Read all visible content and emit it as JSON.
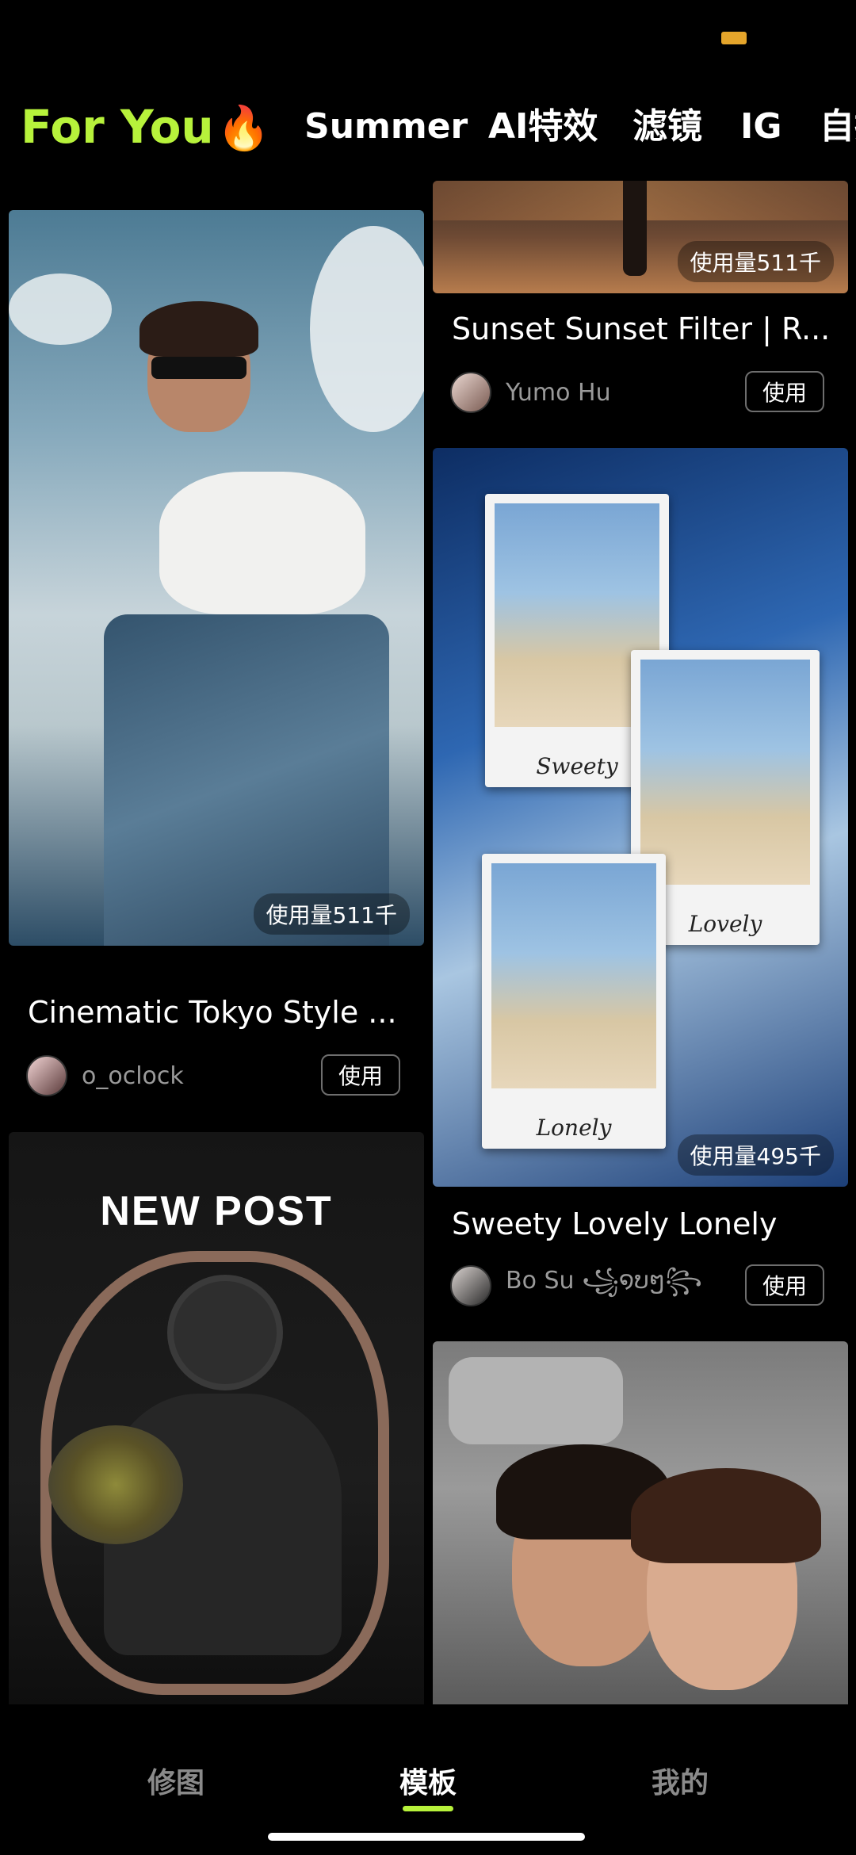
{
  "tabs": [
    {
      "label": "For You",
      "icon": "fire-icon",
      "active": true
    },
    {
      "label": "Summer"
    },
    {
      "label": "AI特效"
    },
    {
      "label": "滤镜"
    },
    {
      "label": "IG"
    },
    {
      "label": "自拍"
    }
  ],
  "cards": [
    {
      "id": "sunset",
      "title": "Sunset Sunset Filter | R...",
      "author": "Yumo Hu",
      "usage": "使用量511千",
      "button": "使用"
    },
    {
      "id": "cinematic",
      "title": "Cinematic Tokyo Style ...",
      "author": "o_oclock",
      "usage": "使用量511千",
      "button": "使用"
    },
    {
      "id": "sweety",
      "title": "Sweety Lovely Lonely",
      "author": "Bo Su ꧁໑ບໆ꧂",
      "usage": "使用量495千",
      "button": "使用",
      "captions": [
        "Sweety",
        "Lovely",
        "Lonely"
      ]
    },
    {
      "id": "newpost",
      "overlay_text": "NEW POST"
    },
    {
      "id": "couple"
    }
  ],
  "bottom_nav": [
    {
      "label": "修图"
    },
    {
      "label": "模板",
      "active": true
    },
    {
      "label": "我的"
    }
  ],
  "colors": {
    "accent": "#b7f23b",
    "background": "#000000"
  }
}
